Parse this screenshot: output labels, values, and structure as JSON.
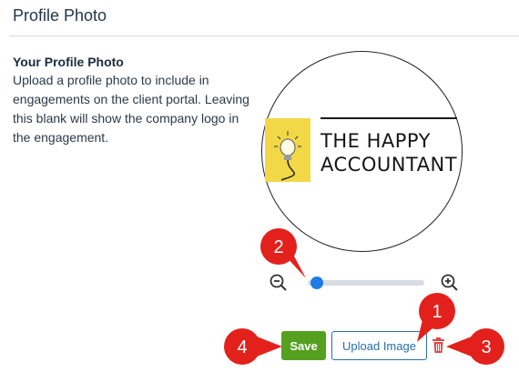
{
  "section": {
    "title": "Profile Photo"
  },
  "description": {
    "heading": "Your Profile Photo",
    "lines": [
      "Upload a profile photo to include in",
      "engagements on the client portal. Leaving",
      "this blank will show the company logo in",
      "the engagement."
    ]
  },
  "logo": {
    "line1": "THE HAPPY",
    "line2": "ACCOUNTANT",
    "accent_color": "#f2d847"
  },
  "zoom": {
    "out_icon": "zoom-out-icon",
    "in_icon": "zoom-in-icon",
    "level": 0.03
  },
  "buttons": {
    "save_label": "Save",
    "upload_label": "Upload Image",
    "delete_icon": "trash-icon"
  },
  "callouts": [
    "1",
    "2",
    "3",
    "4"
  ],
  "colors": {
    "save": "#55a01f",
    "upload": "#2a6fa8",
    "delete": "#e34848",
    "callout": "#e3211c",
    "slider": "#1f7be6"
  }
}
